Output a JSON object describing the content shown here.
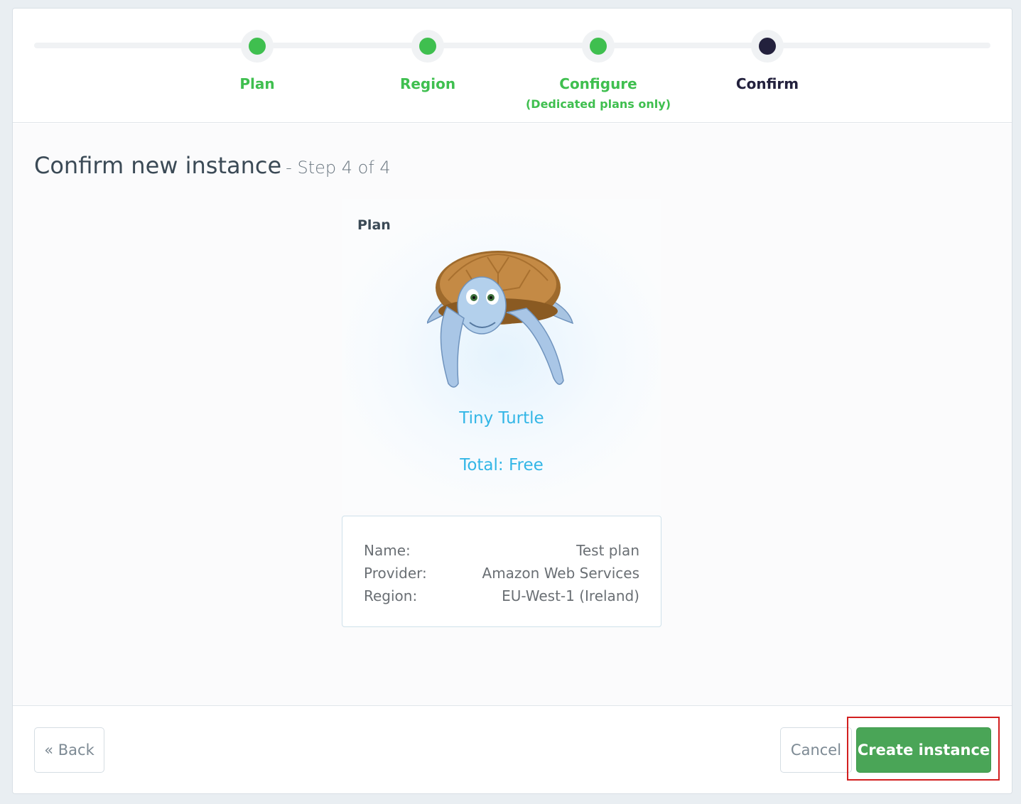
{
  "stepper": {
    "steps": [
      {
        "label": "Plan",
        "sublabel": "",
        "state": "done"
      },
      {
        "label": "Region",
        "sublabel": "",
        "state": "done"
      },
      {
        "label": "Configure",
        "sublabel": "(Dedicated plans only)",
        "state": "done"
      },
      {
        "label": "Confirm",
        "sublabel": "",
        "state": "current"
      }
    ]
  },
  "page": {
    "title": "Confirm new instance",
    "step_text": "- Step 4 of 4"
  },
  "plan": {
    "section_title": "Plan",
    "image_icon": "turtle-illustration",
    "name": "Tiny Turtle",
    "total": "Total: Free"
  },
  "details": {
    "rows": [
      {
        "label": "Name:",
        "value": "Test plan"
      },
      {
        "label": "Provider:",
        "value": "Amazon Web Services"
      },
      {
        "label": "Region:",
        "value": "EU-West-1 (Ireland)"
      }
    ]
  },
  "footer": {
    "back_label": "« Back",
    "cancel_label": "Cancel",
    "create_label": "Create instance"
  },
  "colors": {
    "done": "#3fbf4f",
    "current": "#23213d",
    "accent": "#33b6e6",
    "primary_button": "#4aa557",
    "highlight": "#d21f1f"
  }
}
